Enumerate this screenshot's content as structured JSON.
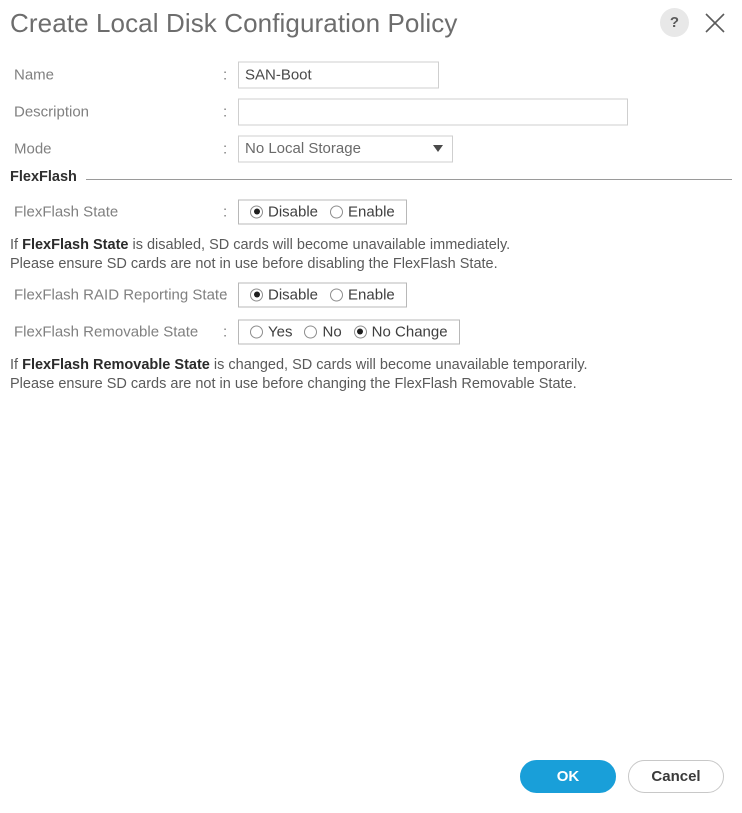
{
  "dialog": {
    "title": "Create Local Disk Configuration Policy",
    "help_icon_label": "?",
    "help_icon_name": "help-icon",
    "close_icon_name": "close-icon"
  },
  "fields": {
    "name": {
      "label": "Name",
      "colon": ":",
      "value": "SAN-Boot",
      "placeholder": ""
    },
    "description": {
      "label": "Description",
      "colon": ":",
      "value": "",
      "placeholder": ""
    },
    "mode": {
      "label": "Mode",
      "colon": ":",
      "value": "No Local Storage",
      "options": [
        "No Local Storage"
      ]
    }
  },
  "flexflash": {
    "section_title": "FlexFlash",
    "state": {
      "label": "FlexFlash State",
      "colon": ":",
      "options": [
        {
          "label": "Disable",
          "selected": true
        },
        {
          "label": "Enable",
          "selected": false
        }
      ]
    },
    "state_note": {
      "line1_pre": "If ",
      "line1_bold": "FlexFlash State",
      "line1_post": " is disabled, SD cards will become unavailable immediately.",
      "line2": "Please ensure SD cards are not in use before disabling the FlexFlash State."
    },
    "raid_reporting_state": {
      "label": "FlexFlash RAID Reporting State",
      "colon": ":",
      "options": [
        {
          "label": "Disable",
          "selected": true
        },
        {
          "label": "Enable",
          "selected": false
        }
      ]
    },
    "removable_state": {
      "label": "FlexFlash Removable State",
      "colon": ":",
      "options": [
        {
          "label": "Yes",
          "selected": false
        },
        {
          "label": "No",
          "selected": false
        },
        {
          "label": "No Change",
          "selected": true
        }
      ]
    },
    "removable_note": {
      "line1_pre": "If ",
      "line1_bold": "FlexFlash Removable State",
      "line1_post": " is changed, SD cards will become unavailable temporarily.",
      "line2": "Please ensure SD cards are not in use before changing the FlexFlash Removable State."
    }
  },
  "footer": {
    "ok_label": "OK",
    "cancel_label": "Cancel"
  },
  "colors": {
    "primary": "#199fd9",
    "title_text": "#6d6d6d",
    "label_text": "#808080",
    "border": "#cfcfcf"
  }
}
